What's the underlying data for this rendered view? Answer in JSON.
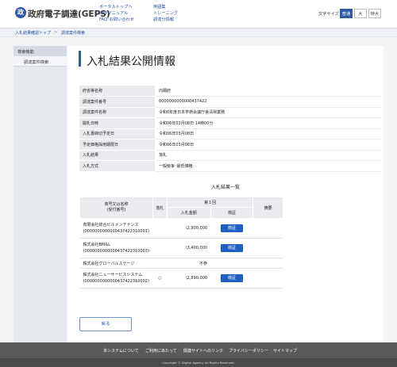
{
  "header": {
    "logo_mark": "政",
    "logo_text": "政府電子調達(GEPS)",
    "links_col1": [
      "ポータルトップへ",
      "操作マニュアル",
      "FAQ･お問い合わせ"
    ],
    "links_col2": [
      "用語集",
      "トレーニング",
      "調達分情報"
    ],
    "font_size_label": "文字サイズ",
    "font_sizes": [
      "普通",
      "大",
      "特大"
    ],
    "font_size_selected": "普通"
  },
  "breadcrumb": [
    "入札結果確認トップ",
    "調達案件検索"
  ],
  "sidebar": {
    "heading": "検索機能",
    "items": [
      "調達案件検索"
    ]
  },
  "page_title": "入札結果公開情報",
  "info_rows": [
    {
      "label": "府省等名称",
      "value": "内閣府"
    },
    {
      "label": "調達案件番号",
      "value": "0000000000000437422"
    },
    {
      "label": "調達案件名称",
      "value": "令和6年度日本学術会議庁舎清掃業務"
    },
    {
      "label": "開札日時",
      "value": "令和06年03月08日 14時00分"
    },
    {
      "label": "入札書締切予定日",
      "value": "令和06年03月08日"
    },
    {
      "label": "予定価格採用期限日",
      "value": "令和06年03月08日"
    },
    {
      "label": "入札結果",
      "value": "落札"
    },
    {
      "label": "入札方式",
      "value": "一般競争･最低価格"
    }
  ],
  "results": {
    "caption": "入札結果一覧",
    "headers": {
      "bidder": "商号又は名称\n(受付番号)",
      "award": "落札",
      "round": "第１回",
      "amount": "入札金額",
      "verify": "検証",
      "remarks": "摘要"
    },
    "rows": [
      {
        "name": "有限会社総合ビルメンテナンス",
        "id": "(0000000000000437422310001)",
        "award": "",
        "amount": "\\2,900,000",
        "verify": "検証",
        "remarks": ""
      },
      {
        "name": "株式会社BM&L",
        "id": "(0000000000000437422310003)",
        "award": "",
        "amount": "\\3,400,000",
        "verify": "検証",
        "remarks": ""
      },
      {
        "name": "株式会社グローバルステージ",
        "id": "",
        "award": "",
        "amount": "不参",
        "verify": "",
        "remarks": ""
      },
      {
        "name": "株式会社ニューサービスシステム",
        "id": "(0000000000000437422310002)",
        "award": "○",
        "amount": "\\2,890,000",
        "verify": "検証",
        "remarks": ""
      }
    ],
    "verify_color": "#1f5fc2"
  },
  "back_button": "戻る",
  "footer": {
    "links": [
      "本システムについて",
      "ご利用にあたって",
      "関連サイトへのリンク",
      "プライバシーポリシー",
      "サイトマップ"
    ],
    "copyright": "Copyright © Digital Agency All Rights Reserved."
  },
  "colors": {
    "accent": "#2e5aa8",
    "footer_bg": "#5a5a5a"
  }
}
